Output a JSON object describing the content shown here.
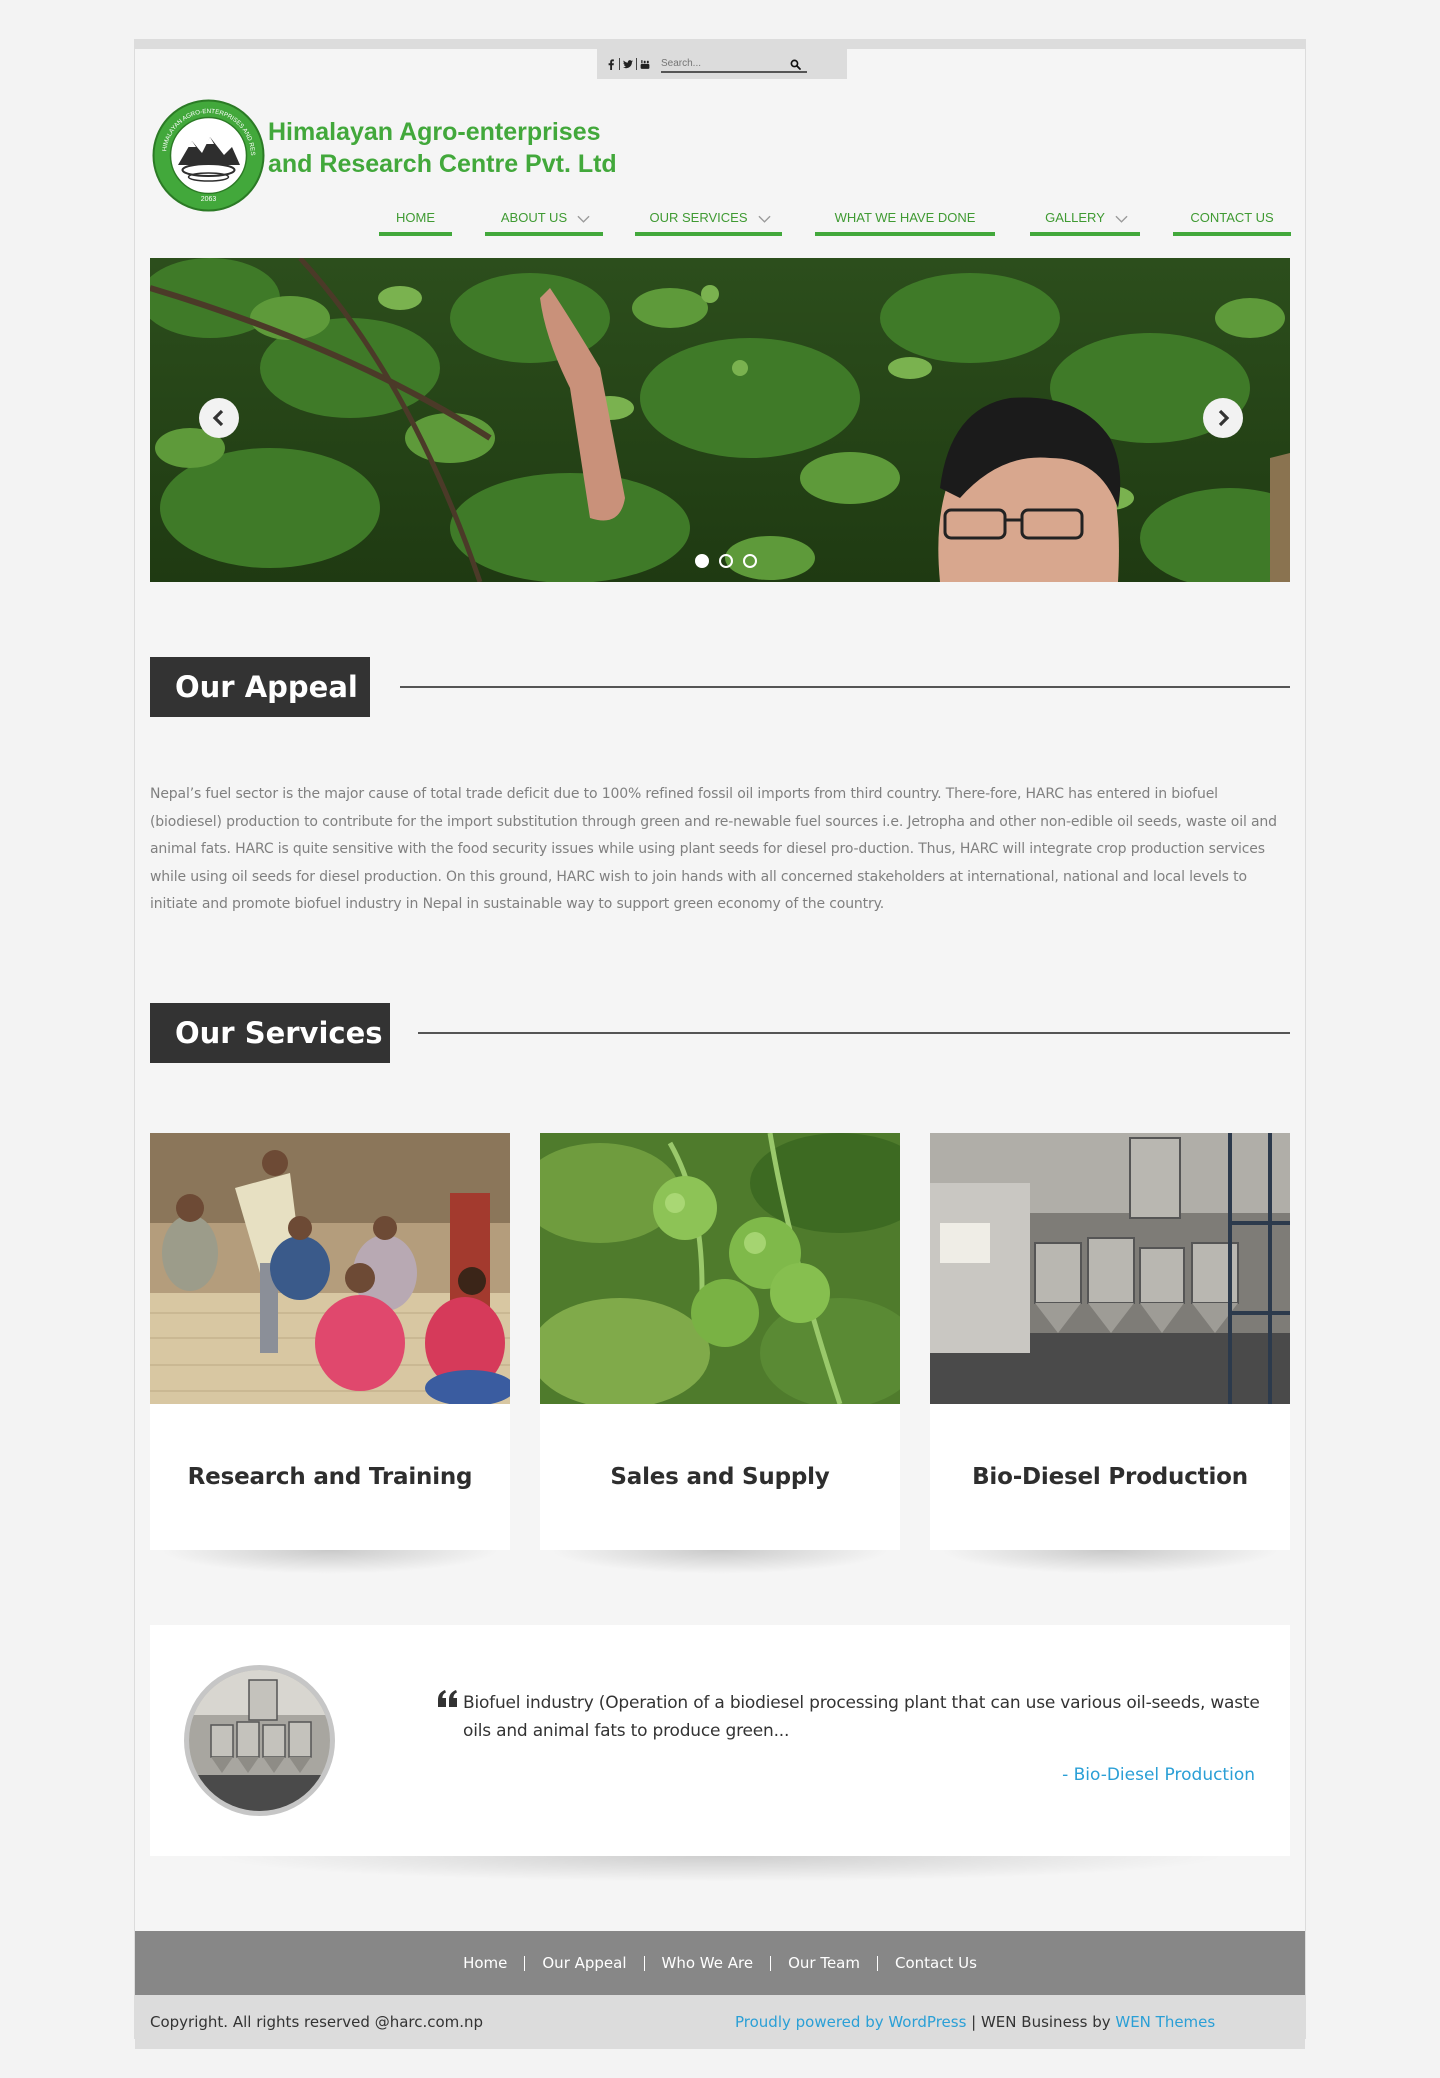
{
  "topbar": {
    "social": [
      "facebook-icon",
      "twitter-icon",
      "youtube-icon"
    ],
    "search_placeholder": "Search..."
  },
  "header": {
    "title_line1": "Himalayan Agro-enterprises",
    "title_line2": "and Research Centre Pvt. Ltd",
    "logo_year": "2063",
    "logo_ring_text": "HIMALAYAN AGRO-ENTERPRISES AND RESEARCH CENTRE PVT. LTD"
  },
  "nav": {
    "items": [
      {
        "label": "HOME",
        "dropdown": false
      },
      {
        "label": "ABOUT US",
        "dropdown": true
      },
      {
        "label": "OUR SERVICES",
        "dropdown": true
      },
      {
        "label": "WHAT WE HAVE DONE",
        "dropdown": false
      },
      {
        "label": "GALLERY",
        "dropdown": true
      },
      {
        "label": "CONTACT US",
        "dropdown": false
      }
    ]
  },
  "slider": {
    "slide_count": 3,
    "active_slide": 1
  },
  "appeal": {
    "heading": "Our Appeal",
    "text": "Nepal’s fuel sector is the major cause of total trade deficit due to 100% refined fossil oil imports from third country. There-fore, HARC has entered in biofuel (biodiesel) production to contribute for the import substitution through green and re-newable fuel sources i.e. Jetropha and other non-edible oil seeds, waste oil and animal fats. HARC is quite sensitive with the food security issues while using plant seeds for diesel pro-duction. Thus, HARC will integrate crop production services while using oil seeds for diesel production. On this ground, HARC wish to join hands with all concerned stakeholders at international, national and local levels to initiate and promote biofuel industry in Nepal in sustainable way to support green economy of the country."
  },
  "services": {
    "heading": "Our Services",
    "items": [
      {
        "title": "Research and Training"
      },
      {
        "title": "Sales and Supply"
      },
      {
        "title": "Bio-Diesel Production"
      }
    ]
  },
  "testimonial": {
    "quote": "Biofuel industry (Operation of a biodiesel processing plant that can use various oil-seeds, waste oils and animal fats to produce green...",
    "author": "- Bio-Diesel Production"
  },
  "footer": {
    "links": [
      "Home",
      "Our Appeal",
      "Who We Are",
      "Our Team",
      "Contact Us"
    ],
    "copyright": "Copyright. All rights reserved @harc.com.np",
    "powered_prefix": "Proudly powered by WordPress",
    "powered_sep": " | WEN Business by ",
    "powered_theme": "WEN Themes"
  },
  "colors": {
    "brand_green": "#42a83b",
    "dark_heading_bg": "#333333",
    "link_blue": "#2a9fd6",
    "footer_grey": "#878787"
  }
}
